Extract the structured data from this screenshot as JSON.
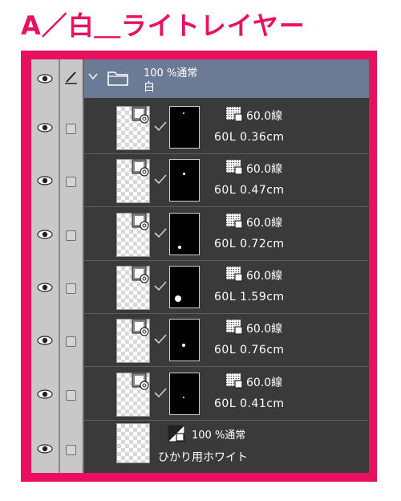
{
  "page": {
    "heading": "A／白＿ライトレイヤー"
  },
  "colors": {
    "frame": "#e8105f",
    "panel": "#3a3a3a",
    "folder_header": "#6b7b96"
  },
  "folder": {
    "mode": "100 %通常",
    "name": "白"
  },
  "layers": [
    {
      "tone_value": "60.0線",
      "info": "60L 0.36cm"
    },
    {
      "tone_value": "60.0線",
      "info": "60L 0.47cm"
    },
    {
      "tone_value": "60.0線",
      "info": "60L 0.72cm"
    },
    {
      "tone_value": "60.0線",
      "info": "60L 1.59cm"
    },
    {
      "tone_value": "60.0線",
      "info": "60L 0.76cm"
    },
    {
      "tone_value": "60.0線",
      "info": "60L 0.41cm"
    }
  ],
  "last_layer": {
    "mode": "100 %通常",
    "name": "ひかり用ホワイト"
  },
  "icons": [
    "eye-icon",
    "pen-icon",
    "chevron-down-icon",
    "folder-icon",
    "layer-effect-icon",
    "check-icon",
    "tone-icon",
    "lock-checkbox"
  ]
}
